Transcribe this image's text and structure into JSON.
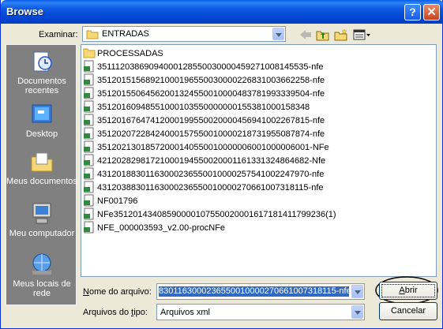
{
  "window": {
    "title": "Browse"
  },
  "lookin": {
    "label": "Examinar:",
    "value": "ENTRADAS"
  },
  "places": [
    {
      "label": "Documentos recentes",
      "icon": "recent-documents-icon"
    },
    {
      "label": "Desktop",
      "icon": "desktop-icon"
    },
    {
      "label": "Meus documentos",
      "icon": "my-documents-icon"
    },
    {
      "label": "Meu computador",
      "icon": "my-computer-icon"
    },
    {
      "label": "Meus locais de rede",
      "icon": "network-places-icon"
    }
  ],
  "files": [
    {
      "name": "PROCESSADAS",
      "type": "folder"
    },
    {
      "name": "35111203869094000128550030000459271008145535-nfe",
      "type": "xml"
    },
    {
      "name": "35120151568921000196550030000226831003662258-nfe",
      "type": "xml"
    },
    {
      "name": "35120155064562001324550010000483781993339504-nfe",
      "type": "xml"
    },
    {
      "name": "35120160948551000103550000000155381000158348",
      "type": "xml"
    },
    {
      "name": "35120167647412000199550020000456941002267815-nfe",
      "type": "xml"
    },
    {
      "name": "35120207228424000157550010000218731955087874-nfe",
      "type": "xml"
    },
    {
      "name": "35120213018572000140550010000006001000006001-NFe",
      "type": "xml"
    },
    {
      "name": "42120282981721000194550020001161331324864682-Nfe",
      "type": "xml"
    },
    {
      "name": "43120188301163000236550010000257541002247970-nfe",
      "type": "xml"
    },
    {
      "name": "43120388301163000236550010000270661007318115-nfe",
      "type": "xml"
    },
    {
      "name": "NF001796",
      "type": "xml"
    },
    {
      "name": "NFe35120143408590000107550020001617181411799236(1)",
      "type": "xml"
    },
    {
      "name": "NFE_000003593_v2.00-procNFe",
      "type": "xml"
    }
  ],
  "filename": {
    "label_pre": "N",
    "label_rest": "ome do arquivo:",
    "value": "8301163000236550010000270661007318115-nfe"
  },
  "filetype": {
    "label_pre": "Arquivos do ",
    "label_ul": "t",
    "label_rest": "ipo:",
    "value": "Arquivos xml"
  },
  "buttons": {
    "open": "Abrir",
    "open_ul": "A",
    "open_rest": "brir",
    "cancel": "Cancelar"
  }
}
